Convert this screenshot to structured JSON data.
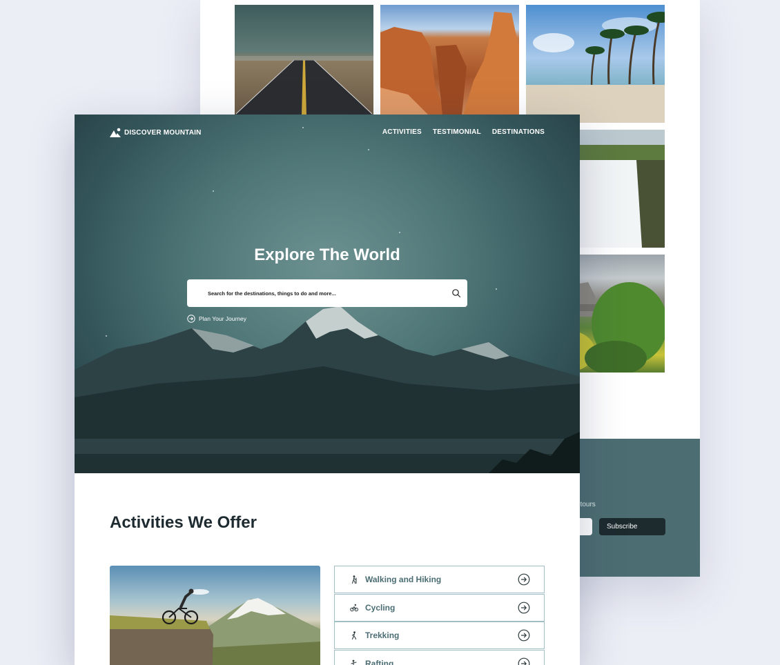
{
  "back_page": {
    "gallery": [
      {
        "name": "road",
        "icon": "photo-road"
      },
      {
        "name": "canyon",
        "icon": "photo-canyon"
      },
      {
        "name": "beach",
        "icon": "photo-beach"
      },
      {
        "name": "waterfall",
        "icon": "photo-waterfall"
      },
      {
        "name": "stone-bridge",
        "icon": "photo-bridge"
      }
    ],
    "newsletter": {
      "text_fragment": "st tours",
      "subscribe_label": "Subscribe"
    }
  },
  "header": {
    "logo_text": "DISCOVER MOUNTAIN",
    "nav": [
      "ACTIVITIES",
      "TESTIMONIAL",
      "DESTINATIONS"
    ]
  },
  "hero": {
    "title": "Explore The World",
    "search_placeholder": "Search for the destinations, things to do and more...",
    "plan_link": "Plan Your Journey"
  },
  "activities": {
    "title": "Activities We Offer",
    "items": [
      {
        "label": "Walking and Hiking",
        "icon": "hiking-icon"
      },
      {
        "label": "Cycling",
        "icon": "cycling-icon"
      },
      {
        "label": "Trekking",
        "icon": "trekking-icon"
      },
      {
        "label": "Rafting",
        "icon": "rafting-icon"
      }
    ]
  },
  "colors": {
    "background": "#eceef6",
    "hero_teal": "#4f7677",
    "newsletter_teal": "#4c6e72",
    "dark": "#1d2a30",
    "accent_text": "#4b6d73",
    "list_border": "#9fbfc4"
  }
}
